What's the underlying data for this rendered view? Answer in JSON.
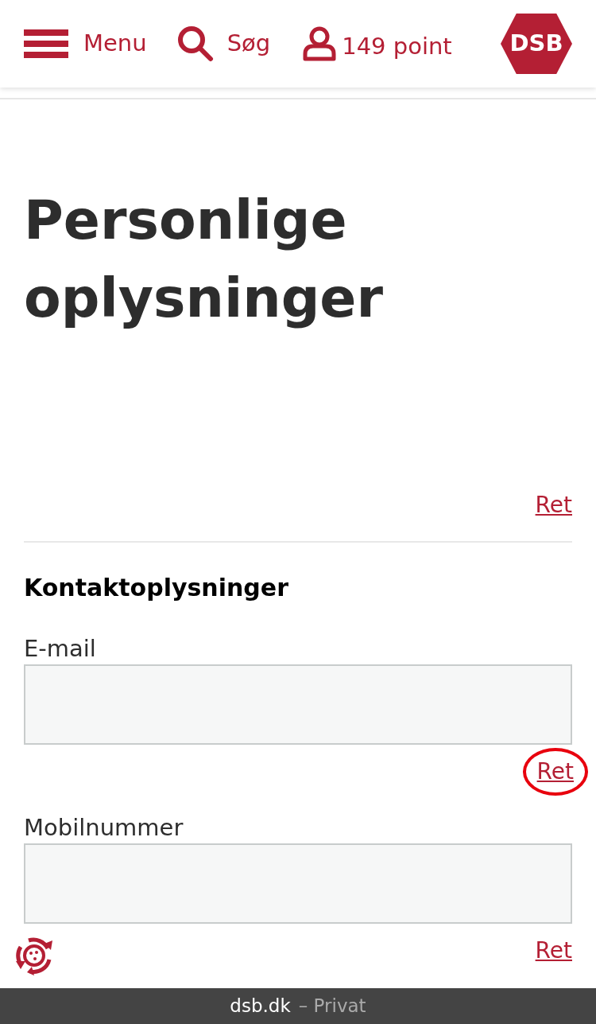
{
  "header": {
    "menu_label": "Menu",
    "search_label": "Søg",
    "points_label": "149 point",
    "logo": "DSB"
  },
  "title": "Personlige oplysninger",
  "top_link": "Ret",
  "section": {
    "heading": "Kontaktoplysninger",
    "fields": [
      {
        "label": "E-mail",
        "link": "Ret",
        "highlighted": true
      },
      {
        "label": "Mobilnummer",
        "link": "Ret",
        "highlighted": false
      }
    ]
  },
  "footer": {
    "domain": "dsb.dk",
    "suffix": "– Privat"
  }
}
